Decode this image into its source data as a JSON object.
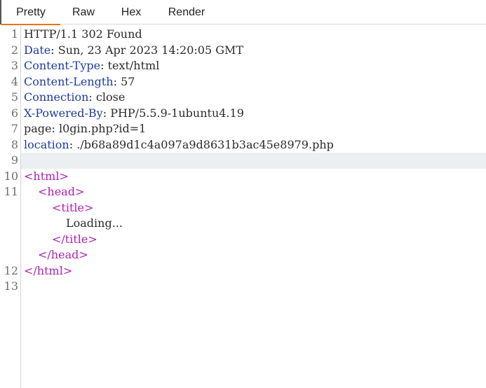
{
  "tabs": [
    {
      "label": "Pretty",
      "active": true
    },
    {
      "label": "Raw",
      "active": false
    },
    {
      "label": "Hex",
      "active": false
    },
    {
      "label": "Render",
      "active": false
    }
  ],
  "colors": {
    "accent_tab": "#e8731a",
    "header_key": "#1e3ca0",
    "html_tag": "#b022b0",
    "highlight_row": "#eceff1"
  },
  "response": {
    "status_line": "HTTP/1.1 302 Found",
    "headers": [
      {
        "key": "Date",
        "sep": ": ",
        "value": "Sun, 23 Apr 2023 14:20:05 GMT"
      },
      {
        "key": "Content-Type",
        "sep": ": ",
        "value": "text/html"
      },
      {
        "key": "Content-Length",
        "sep": ": ",
        "value": "57"
      },
      {
        "key": "Connection",
        "sep": ": ",
        "value": "close"
      },
      {
        "key": "X-Powered-By",
        "sep": ": ",
        "value": "PHP/5.5.9-1ubuntu4.19"
      },
      {
        "key": "page",
        "sep": ": ",
        "value": "l0gin.php?id=1"
      },
      {
        "key": "location",
        "sep": ": ",
        "value": "./b68a89d1c4a097a9d8631b3ac45e8979.php"
      }
    ],
    "body": {
      "html_open": "html",
      "head_open": "head",
      "title_open": "title",
      "title_text": "Loading...",
      "title_close": "/title",
      "head_close": "/head",
      "html_close": "/html"
    }
  },
  "line_numbers": [
    "1",
    "2",
    "3",
    "4",
    "5",
    "6",
    "7",
    "8",
    "9",
    "10",
    "11",
    "12",
    "13"
  ]
}
